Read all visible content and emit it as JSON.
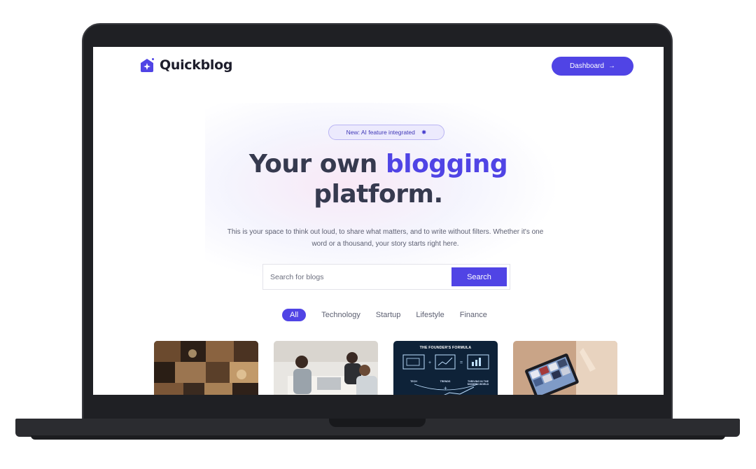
{
  "brand": {
    "name": "Quickblog",
    "accent": "#5044e5"
  },
  "header": {
    "dashboard_label": "Dashboard",
    "dashboard_icon": "arrow-right-icon"
  },
  "hero": {
    "badge_text": "New: AI feature integrated",
    "badge_icon": "sparkle-icon",
    "title_part1": "Your own ",
    "title_accent": "blogging",
    "title_part2": "platform.",
    "subtitle": "This is your space to think out loud, to share what matters, and to write without filters. Whether it's one word or a thousand, your story starts right here."
  },
  "search": {
    "placeholder": "Search for blogs",
    "button_label": "Search"
  },
  "categories": [
    {
      "label": "All",
      "active": true
    },
    {
      "label": "Technology",
      "active": false
    },
    {
      "label": "Startup",
      "active": false
    },
    {
      "label": "Lifestyle",
      "active": false
    },
    {
      "label": "Finance",
      "active": false
    }
  ],
  "cards": [
    {
      "image": "collage-photo"
    },
    {
      "image": "team-meeting-photo"
    },
    {
      "image": "founders-formula-graphic",
      "art_title": "THE FOUNDER'S FORMULA",
      "art_labels": [
        "TECH",
        "TRENDS",
        "THRIVING IN THE MODERN WORLD"
      ]
    },
    {
      "image": "tablet-photo"
    }
  ]
}
